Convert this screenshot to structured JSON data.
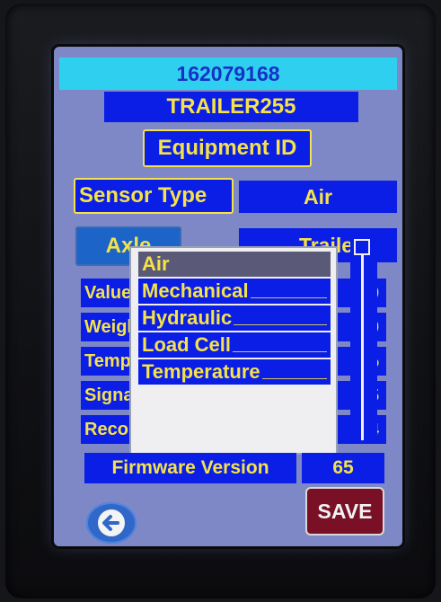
{
  "header": {
    "id_number": "162079168",
    "trailer_name": "TRAILER255",
    "equipment_button": "Equipment ID"
  },
  "sensor": {
    "label": "Sensor Type",
    "value": "Air"
  },
  "axle": {
    "label": "Axle",
    "value": "Trailer"
  },
  "rows": [
    {
      "label": "Value",
      "value": "0"
    },
    {
      "label": "Weight",
      "value": "0"
    },
    {
      "label": "Temp",
      "value": "%"
    },
    {
      "label": "Signal",
      "value": "5"
    },
    {
      "label": "Record",
      "value": "4"
    }
  ],
  "dropdown": {
    "options": [
      "Air",
      "Mechanical",
      "Hydraulic",
      "Load Cell",
      "Temperature"
    ],
    "selected": "Air"
  },
  "firmware": {
    "label": "Firmware Version",
    "value": "65"
  },
  "actions": {
    "back_icon": "arrow-left-icon",
    "save_label": "SAVE"
  },
  "colors": {
    "screen_bg": "#7e88c6",
    "field_bg": "#0a1ee6",
    "text_yellow": "#f5e24a",
    "id_bar": "#2fd0ef",
    "save_bg": "#7a1026"
  }
}
